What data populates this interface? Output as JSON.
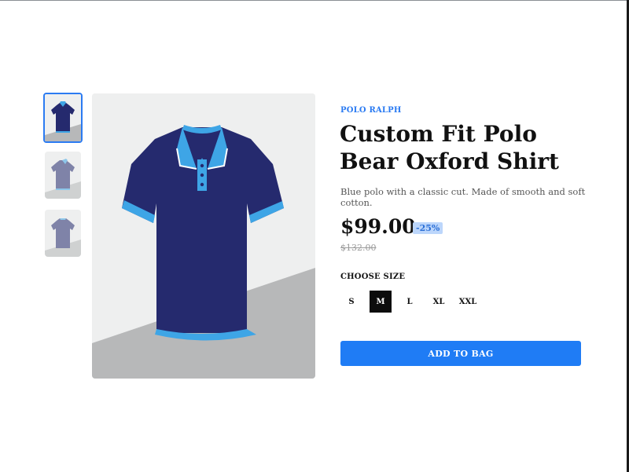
{
  "product": {
    "brand": "POLO RALPH",
    "title": "Custom Fit Polo Bear Oxford Shirt",
    "description": "Blue polo with a classic cut. Made of smooth and soft cotton.",
    "price": "$99.00",
    "discount": "-25%",
    "old_price": "$132.00"
  },
  "size_selector": {
    "label": "CHOOSE SIZE",
    "options": [
      "S",
      "M",
      "L",
      "XL",
      "XXL"
    ],
    "selected": "M"
  },
  "cta": {
    "label": "ADD TO BAG"
  },
  "colors": {
    "accent": "#2b7bf2",
    "shirt_body": "#252a6e",
    "shirt_trim": "#3ea5e6",
    "badge_bg": "#bcd6fb",
    "button_bg": "#1f7cf5"
  },
  "icons": {
    "product_image": "polo-shirt-image",
    "thumbnail": "polo-shirt-thumbnail"
  }
}
